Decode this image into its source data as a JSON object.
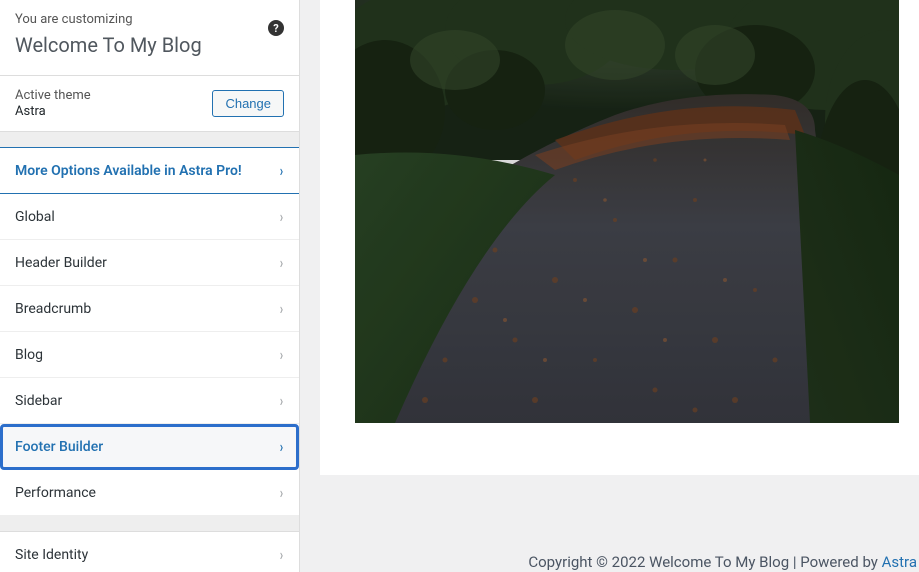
{
  "header": {
    "customizing_label": "You are customizing",
    "site_title": "Welcome To My Blog",
    "help_glyph": "?"
  },
  "theme": {
    "label": "Active theme",
    "name": "Astra",
    "change_btn": "Change"
  },
  "menu": {
    "promo": "More Options Available in Astra Pro!",
    "items": [
      "Global",
      "Header Builder",
      "Breadcrumb",
      "Blog",
      "Sidebar",
      "Footer Builder",
      "Performance"
    ],
    "extra": [
      "Site Identity"
    ],
    "selected_index": 5
  },
  "footer": {
    "text_before": "Copyright © 2022 Welcome To My Blog | Powered by ",
    "link": "Astra"
  }
}
